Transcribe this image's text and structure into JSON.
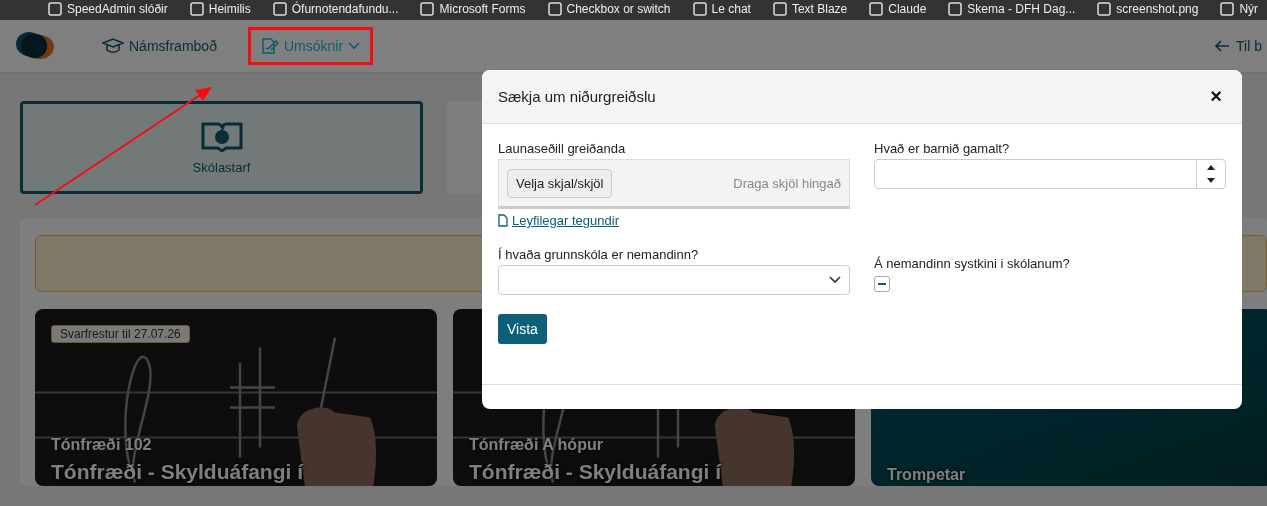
{
  "bookmarks": [
    {
      "label": "SpeedAdmin slóðir"
    },
    {
      "label": "Heimilis"
    },
    {
      "label": "Ófurnotendafundu..."
    },
    {
      "label": "Microsoft Forms"
    },
    {
      "label": "Checkbox or switch"
    },
    {
      "label": "Le chat"
    },
    {
      "label": "Text Blaze"
    },
    {
      "label": "Claude"
    },
    {
      "label": "Skema - DFH Dag..."
    },
    {
      "label": "screenshot.png"
    },
    {
      "label": "Nýr"
    }
  ],
  "nav": {
    "items": [
      {
        "label": "Námsframboð",
        "kind": "courses",
        "highlighted": false
      },
      {
        "label": "Umsóknir",
        "kind": "applications",
        "highlighted": true
      }
    ],
    "back_link": "Til b"
  },
  "categories": [
    {
      "label": "Skólastarf",
      "selected": true
    }
  ],
  "courses": [
    {
      "badge": "Svarfrestur til 27.07.26",
      "subtitle": "Tónfræði 102",
      "title": "Tónfræði - Skylduáfangi í"
    },
    {
      "subtitle": "Tónfræði A hópur",
      "title": "Tónfræði - Skylduáfangi í"
    },
    {
      "kind": "plain",
      "subtitle": "Trompetar"
    }
  ],
  "modal": {
    "title": "Sækja um niðurgreiðslu",
    "close": "×",
    "upload": {
      "label": "Launaseðill greiðanda",
      "button": "Velja skjal/skjöl",
      "drop_hint": "Draga skjöl hingað",
      "link": "Leyfilegar tegundir"
    },
    "age": {
      "label": "Hvað er barnið gamalt?"
    },
    "school": {
      "label": "Í hvaða grunnskóla er nemandinn?"
    },
    "siblings": {
      "label": "Á nemandinn systkini i skólanum?",
      "indeterminate": true
    },
    "submit": "Vista"
  }
}
